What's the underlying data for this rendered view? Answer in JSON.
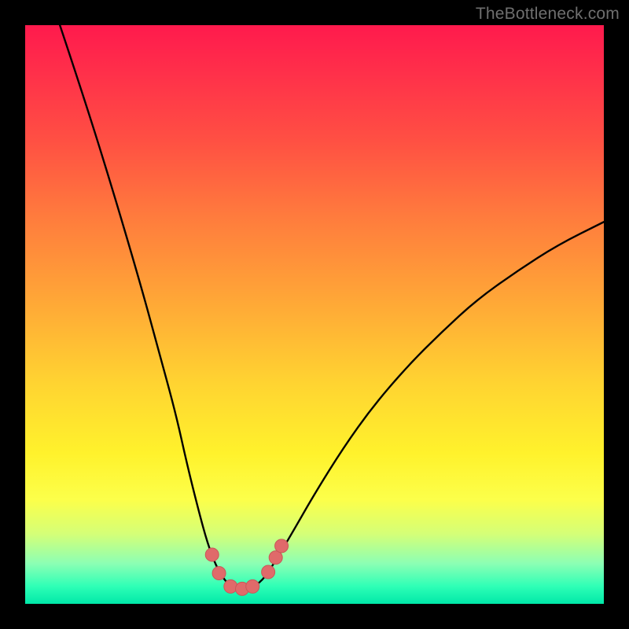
{
  "watermark": "TheBottleneck.com",
  "colors": {
    "curve_stroke": "#000000",
    "marker_fill": "#e06a6a",
    "marker_stroke": "#c95858",
    "background_black": "#000000"
  },
  "chart_data": {
    "type": "line",
    "title": "",
    "xlabel": "",
    "ylabel": "",
    "xlim": [
      0,
      100
    ],
    "ylim": [
      0,
      100
    ],
    "grid": false,
    "legend": false,
    "series": [
      {
        "name": "bottleneck-curve",
        "x": [
          6,
          10,
          15,
          20,
          23,
          26,
          28,
          30,
          31.5,
          33,
          34.5,
          36,
          37.5,
          39,
          41,
          43,
          46,
          50,
          55,
          60,
          66,
          72,
          78,
          85,
          92,
          100
        ],
        "values": [
          100,
          88,
          72,
          55,
          44,
          33,
          24,
          16,
          10.5,
          6.5,
          4,
          2.7,
          2.5,
          2.7,
          4,
          7,
          12,
          19,
          27,
          34,
          41,
          47,
          52.5,
          57.5,
          62,
          66
        ]
      }
    ],
    "markers": [
      {
        "x": 32.3,
        "y": 8.5
      },
      {
        "x": 33.5,
        "y": 5.3
      },
      {
        "x": 35.5,
        "y": 3.0
      },
      {
        "x": 37.5,
        "y": 2.6
      },
      {
        "x": 39.3,
        "y": 3.0
      },
      {
        "x": 42.0,
        "y": 5.5
      },
      {
        "x": 43.3,
        "y": 8.0
      },
      {
        "x": 44.3,
        "y": 10.0
      }
    ]
  }
}
